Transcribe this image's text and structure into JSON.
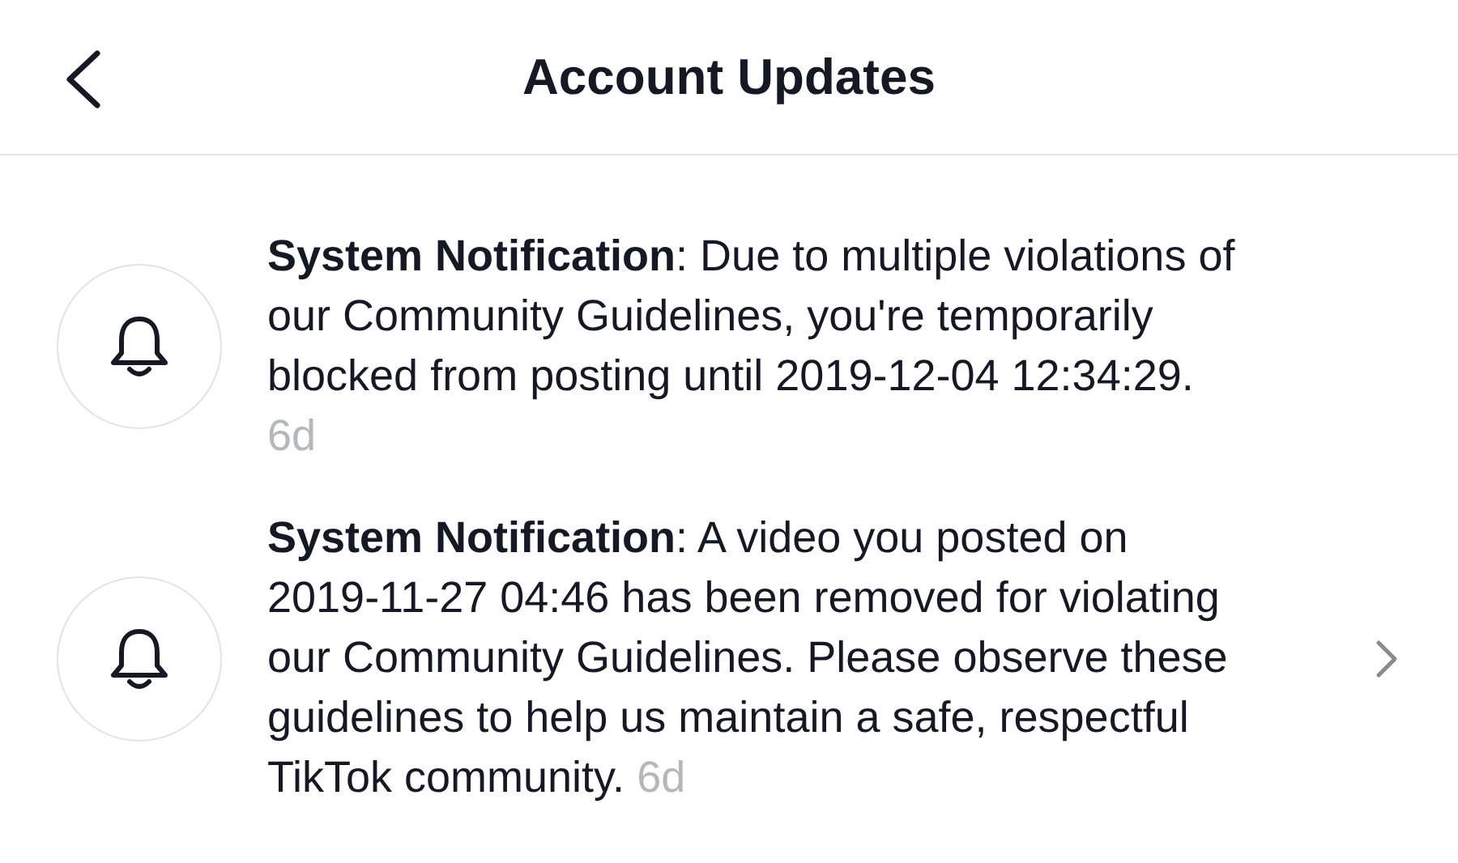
{
  "header": {
    "title": "Account Updates"
  },
  "notifications": [
    {
      "message": "**System Notification**: Due to multiple violations of our Community Guidelines, you're temporarily blocked from posting until 2019-12-04 12:34:29.",
      "time": "6d",
      "has_detail": false
    },
    {
      "message": "**System Notification**: A video you posted on 2019-11-27 04:46 has been removed for violating our Community Guidelines. Please observe these guidelines to help us maintain a safe, respectful TikTok community.",
      "time": "6d",
      "has_detail": true
    }
  ]
}
